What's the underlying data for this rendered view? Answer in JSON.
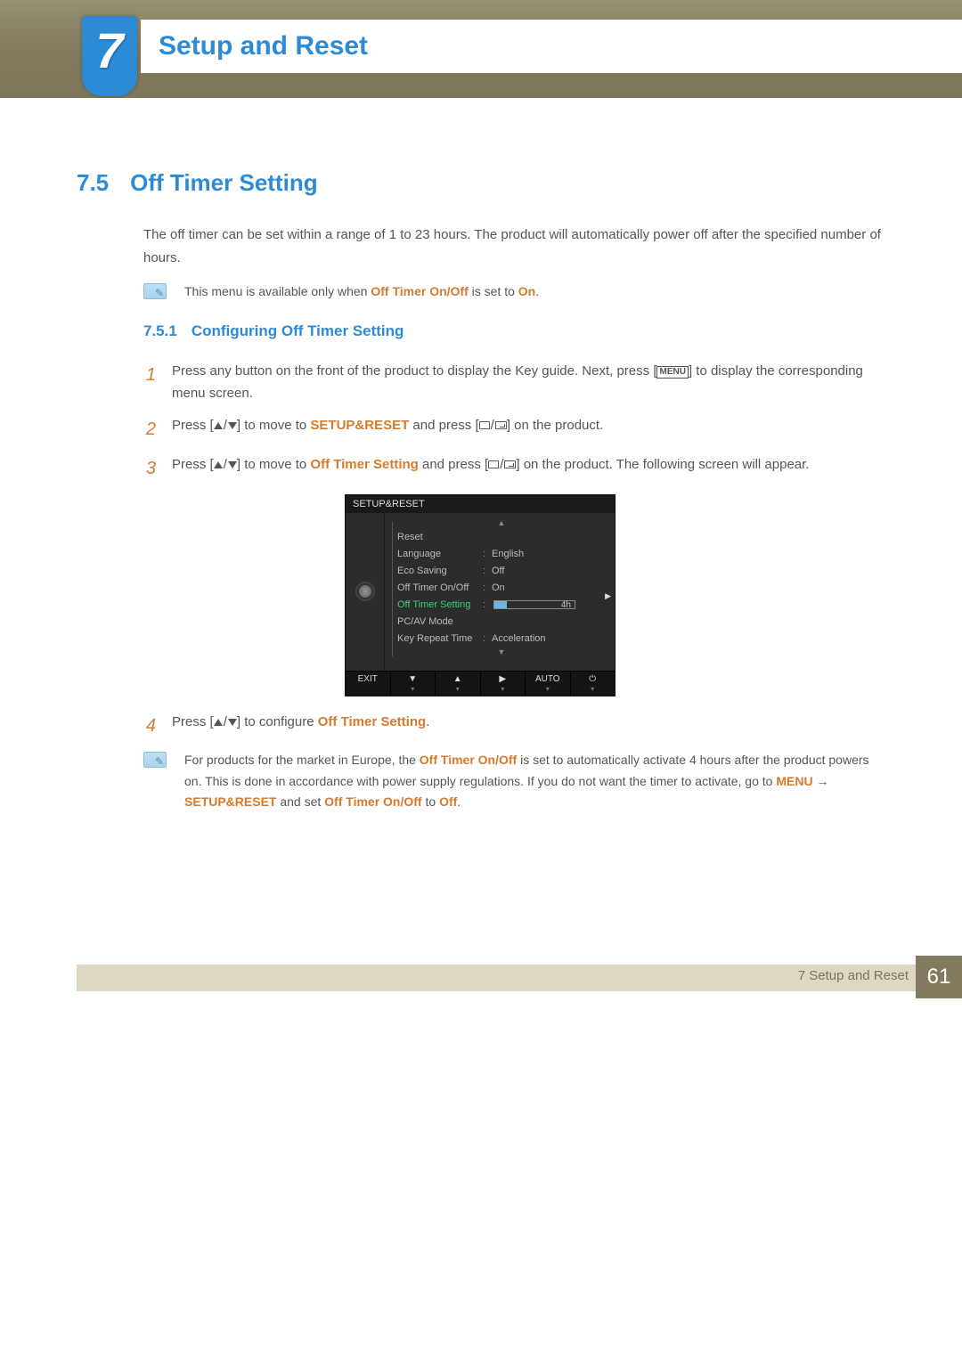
{
  "chapter": {
    "number": "7",
    "title": "Setup and Reset"
  },
  "section": {
    "number": "7.5",
    "title": "Off Timer Setting"
  },
  "intro": "The off timer can be set within a range of 1 to 23 hours. The product will automatically power off after the specified number of hours.",
  "note1": {
    "pre": "This menu is available only when ",
    "b1": "Off Timer On/Off",
    "mid": " is set to ",
    "b2": "On",
    "post": "."
  },
  "subsection": {
    "number": "7.5.1",
    "title": "Configuring Off Timer Setting"
  },
  "steps": {
    "s1": {
      "n": "1",
      "pre": "Press any button on the front of the product to display the Key guide. Next, press [",
      "key": "MENU",
      "post": "] to display the corresponding menu screen."
    },
    "s2": {
      "n": "2",
      "pre": "Press [",
      "mid1": "] to move to ",
      "target": "SETUP&RESET",
      "mid2": " and press [",
      "post": "] on the product."
    },
    "s3": {
      "n": "3",
      "pre": "Press [",
      "mid1": "] to move to ",
      "target": "Off Timer Setting",
      "mid2": " and press [",
      "post": "] on the product. The following screen will appear."
    },
    "s4": {
      "n": "4",
      "pre": "Press [",
      "mid": "] to configure ",
      "target": "Off Timer Setting",
      "post": "."
    }
  },
  "note2": {
    "pre": "For products for the market in Europe, the ",
    "b1": "Off Timer On/Off",
    "mid1": " is set to automatically activate 4 hours after the product powers on. This is done in accordance with power supply regulations. If you do not want the timer to activate, go to ",
    "b2": "MENU",
    "arrow": " → ",
    "b3": "SETUP&RESET",
    "mid2": " and set ",
    "b4": "Off Timer On/Off",
    "mid3": " to ",
    "b5": "Off",
    "post": "."
  },
  "osd": {
    "title": "SETUP&RESET",
    "rows": [
      {
        "label": "Reset",
        "value": ""
      },
      {
        "label": "Language",
        "value": "English"
      },
      {
        "label": "Eco Saving",
        "value": "Off"
      },
      {
        "label": "Off Timer On/Off",
        "value": "On"
      },
      {
        "label": "Off Timer Setting",
        "value": "4h",
        "slider": true,
        "selected": true
      },
      {
        "label": "PC/AV Mode",
        "value": ""
      },
      {
        "label": "Key Repeat Time",
        "value": "Acceleration"
      }
    ],
    "footer": [
      "EXIT",
      "▼",
      "▲",
      "▶",
      "AUTO",
      "⏻"
    ]
  },
  "footer": {
    "label": "7 Setup and Reset",
    "page": "61"
  }
}
